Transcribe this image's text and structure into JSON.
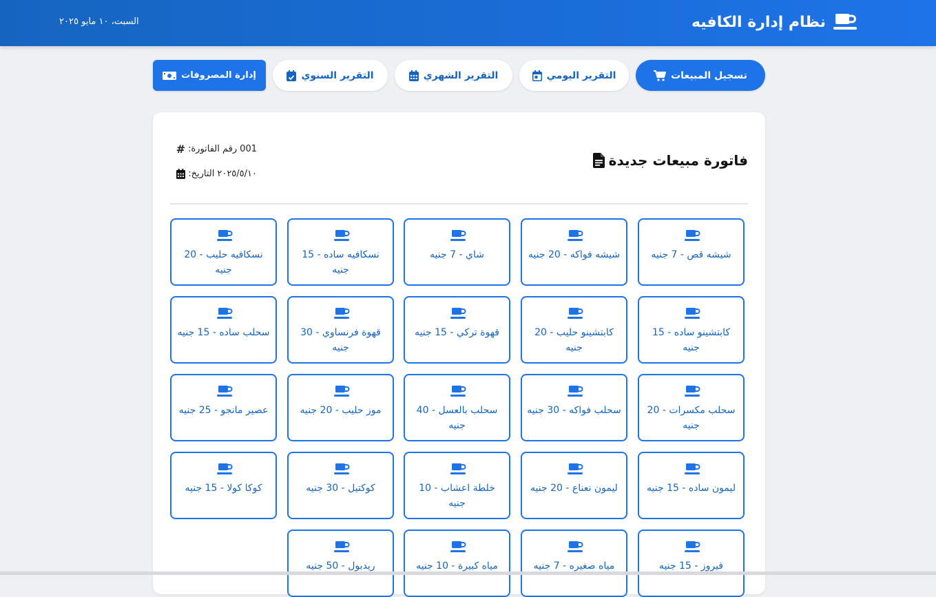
{
  "app": {
    "title": "نظام إدارة الكافيه",
    "date": "السبت، ١٠ مايو ٢٠٢٥",
    "icon": "coffee-cup-icon"
  },
  "colors": {
    "primary": "#1e73e8",
    "primary_dark": "#1565c0",
    "background": "#eef0f4"
  },
  "nav": {
    "sales": {
      "label": "تسجيل المبيعات",
      "icon": "cart-icon"
    },
    "daily": {
      "label": "التقرير اليومي",
      "icon": "calendar-day-icon"
    },
    "monthly": {
      "label": "التقرير الشهري",
      "icon": "calendar-icon"
    },
    "yearly": {
      "label": "التقرير السنوي",
      "icon": "calendar-check-icon"
    },
    "expenses": {
      "label": "إدارة المصروفات",
      "icon": "money-bill-icon"
    }
  },
  "invoice": {
    "title": "فاتورة مبيعات جديدة",
    "number_label": "رقم الفاتورة:",
    "number": "001",
    "date_label": "التاريخ:",
    "date": "٢٠٢٥/٥/١٠"
  },
  "products": [
    "شيشه قص - 7 جنيه",
    "شيشه فواكه - 20 جنيه",
    "شاي - 7 جنيه",
    "نسكافيه ساده - 15 جنيه",
    "نسكافيه حليب - 20 جنيه",
    "كابتشينو ساده - 15 جنيه",
    "كابتشينو حليب - 20 جنيه",
    "قهوة تركي - 15 جنيه",
    "قهوة فرنساوي - 30 جنيه",
    "سحلب ساده - 15 جنيه",
    "سحلب مكسرات - 20 جنيه",
    "سحلب فواكه - 30 جنيه",
    "سحلب بالعسل - 40 جنيه",
    "موز حليب - 20 جنيه",
    "عصير مانجو - 25 جنيه",
    "ليمون ساده - 15 جنيه",
    "ليمون نعناع - 20 جنيه",
    "خلطة اعشاب - 10 جنيه",
    "كوكتيل - 30 جنيه",
    "كوكا كولا - 15 جنيه",
    "فيروز - 15 جنيه",
    "مياه صغيره - 7 جنيه",
    "مياه كبيرة - 10 جنيه",
    "ريدبول - 50 جنيه"
  ]
}
